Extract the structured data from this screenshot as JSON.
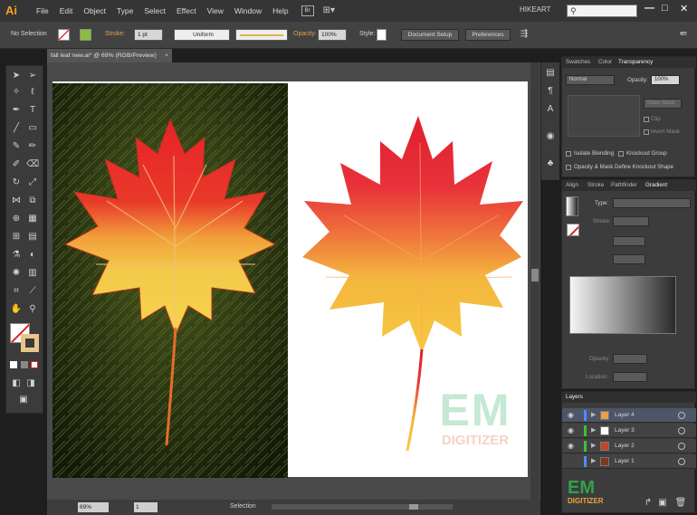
{
  "app": {
    "logo": "Ai",
    "workspace": "HIKEART",
    "search_icon": "search-icon"
  },
  "menu": [
    "File",
    "Edit",
    "Object",
    "Type",
    "Select",
    "Effect",
    "View",
    "Window",
    "Help"
  ],
  "menu_br": "Br",
  "window_controls": {
    "minimize": "—",
    "maximize": "□",
    "close": "✕"
  },
  "control_bar": {
    "selection": "No Selection",
    "stroke_label": "Stroke:",
    "stroke_value": "1 pt",
    "profile": "Uniform",
    "opacity_label": "Opacity:",
    "opacity_value": "100%",
    "style_label": "Style:",
    "document_setup": "Document Setup",
    "preferences": "Preferences"
  },
  "document": {
    "tab_title": "fall leaf new.ai* @ 69% (RGB/Preview)",
    "close": "×"
  },
  "status_bar": {
    "zoom": "69%",
    "artboard": "1",
    "mode": "Selection"
  },
  "transparency_panel": {
    "tabs": [
      "Swatches",
      "Color",
      "Transparency"
    ],
    "active_tab": "Transparency",
    "blend_mode": "Normal",
    "opacity_label": "Opacity:",
    "opacity_value": "100%",
    "make_mask": "Make Mask",
    "clip": "Clip",
    "invert_mask": "Invert Mask",
    "isolate_blending": "Isolate Blending",
    "knockout_group": "Knockout Group",
    "opacity_mask": "Opacity & Mask Define Knockout Shape"
  },
  "gradient_panel": {
    "tabs": [
      "Align",
      "Stroke",
      "Pathfinder",
      "Gradient"
    ],
    "active_tab": "Gradient",
    "type_label": "Type:",
    "stroke_label": "Stroke:",
    "opacity_label": "Opacity:",
    "location_label": "Location:"
  },
  "layers_panel": {
    "title": "Layers",
    "layers": [
      {
        "name": "Layer 4",
        "color": "#4f8bff"
      },
      {
        "name": "Layer 3",
        "color": "#38c438"
      },
      {
        "name": "Layer 2",
        "color": "#38c438"
      },
      {
        "name": "Layer 1",
        "color": "#4f8bff"
      }
    ]
  },
  "watermark": {
    "big": "EM",
    "small": "DIGITIZER"
  },
  "watermark_corner": {
    "big": "EM",
    "small": "DIGITIZER"
  },
  "colors": {
    "accent": "#f7a21b",
    "panel": "#3c3c3c",
    "bar": "#353535"
  }
}
